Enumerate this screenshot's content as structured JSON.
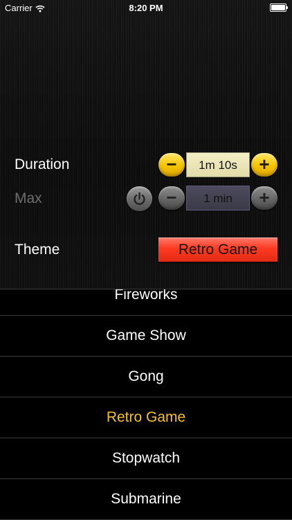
{
  "status_bar": {
    "carrier": "Carrier",
    "time": "8:20 PM",
    "wifi_icon": "wifi-icon",
    "battery_icon": "battery-icon"
  },
  "duration": {
    "label": "Duration",
    "minus": "−",
    "value": "1m 10s",
    "plus": "+"
  },
  "max": {
    "label": "Max",
    "power_icon": "power-icon",
    "minus": "−",
    "value": "1 min",
    "plus": "+"
  },
  "theme": {
    "label": "Theme",
    "selected": "Retro Game"
  },
  "theme_list": {
    "items": [
      "Fireworks",
      "Game Show",
      "Gong",
      "Retro Game",
      "Stopwatch",
      "Submarine"
    ],
    "selected_index": 3,
    "selected_color": "#f6c125"
  },
  "colors": {
    "stepper_active": "#f5c400",
    "stepper_inactive": "#666666",
    "theme_button": "#ff3a22"
  }
}
